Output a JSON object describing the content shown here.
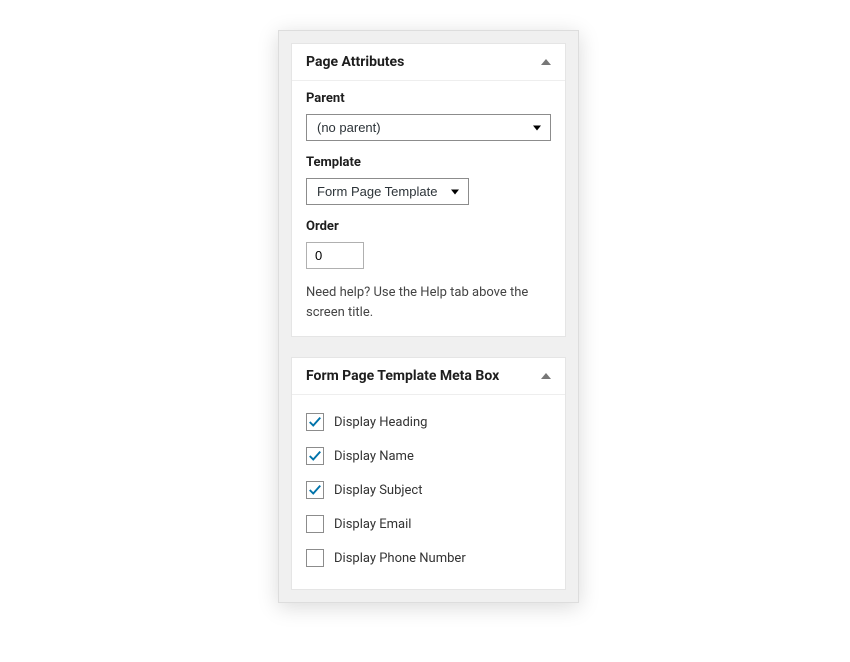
{
  "pageAttributes": {
    "title": "Page Attributes",
    "parentLabel": "Parent",
    "parentValue": "(no parent)",
    "templateLabel": "Template",
    "templateValue": "Form Page Template",
    "orderLabel": "Order",
    "orderValue": "0",
    "helpText": "Need help? Use the Help tab above the screen title."
  },
  "metaBox": {
    "title": "Form Page Template Meta Box",
    "options": [
      {
        "label": "Display Heading",
        "checked": true
      },
      {
        "label": "Display Name",
        "checked": true
      },
      {
        "label": "Display Subject",
        "checked": true
      },
      {
        "label": "Display Email",
        "checked": false
      },
      {
        "label": "Display Phone Number",
        "checked": false
      }
    ]
  }
}
